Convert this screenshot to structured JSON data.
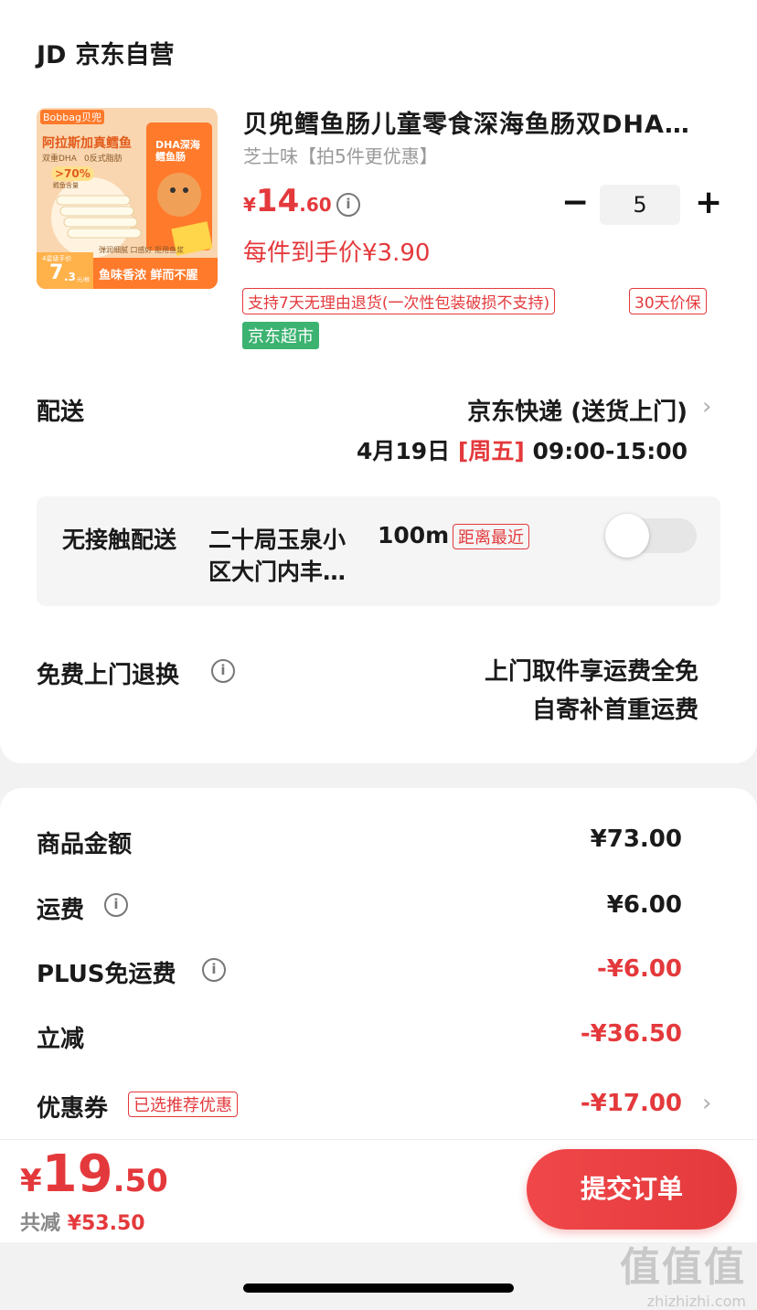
{
  "shop": {
    "logo": "JD",
    "name": "京东自营"
  },
  "product": {
    "image_text": {
      "brand": "Bobbag贝兜",
      "headline": "阿拉斯加真鳕鱼",
      "sub1": "双重DHA",
      "sub2": "0反式脂肪",
      "badge": ">70%",
      "badge_sub": "鳕鱼含量",
      "pack_title": "DHA深海鳕鱼肠",
      "feats": "弹润细腻 口感好 拒用鱼浆",
      "price_label": "4星级手价",
      "price_big": "7",
      "price_small": ".3",
      "price_unit": "元/根",
      "slogan": "鱼味香浓 鲜而不腥"
    },
    "title": "贝兜鳕鱼肠儿童零食深海鱼肠双DHA…",
    "spec": "芝士味【拍5件更优惠】",
    "price_symbol": "¥",
    "price_int": "14",
    "price_dec": ".60",
    "quantity": "5",
    "unit_price": "每件到手价¥3.90",
    "tags": [
      "支持7天无理由退货(一次性包装破损不支持)",
      "30天价保"
    ],
    "market_tag": "京东超市"
  },
  "delivery": {
    "label": "配送",
    "method": "京东快递 (送货上门)",
    "date": "4月19日",
    "weekday": "[周五]",
    "time": "09:00-15:00"
  },
  "contactless": {
    "label": "无接触配送",
    "address_line1": "二十局玉泉小",
    "address_line2": "区大门内丰…",
    "distance": "100m",
    "distance_tag": "距离最近",
    "enabled": false
  },
  "returns": {
    "label": "免费上门退换",
    "line1": "上门取件享运费全免",
    "line2": "自寄补首重运费"
  },
  "summary": {
    "goods": {
      "label": "商品金额",
      "value": "¥73.00"
    },
    "shipping": {
      "label": "运费",
      "value": "¥6.00"
    },
    "plus": {
      "label": "PLUS免运费",
      "value": "-¥6.00"
    },
    "discount": {
      "label": "立减",
      "value": "-¥36.50"
    },
    "coupon": {
      "label": "优惠券",
      "tag": "已选推荐优惠",
      "value": "-¥17.00"
    }
  },
  "bottom": {
    "symbol": "¥",
    "total_int": "19",
    "total_dec": ".50",
    "saved_label": "共减",
    "saved_value": "¥53.50",
    "submit": "提交订单"
  },
  "watermark": {
    "chars": "值值值",
    "url": "zhizhizhi.com"
  },
  "colors": {
    "accent": "#e4393c",
    "market": "#3cb371"
  }
}
